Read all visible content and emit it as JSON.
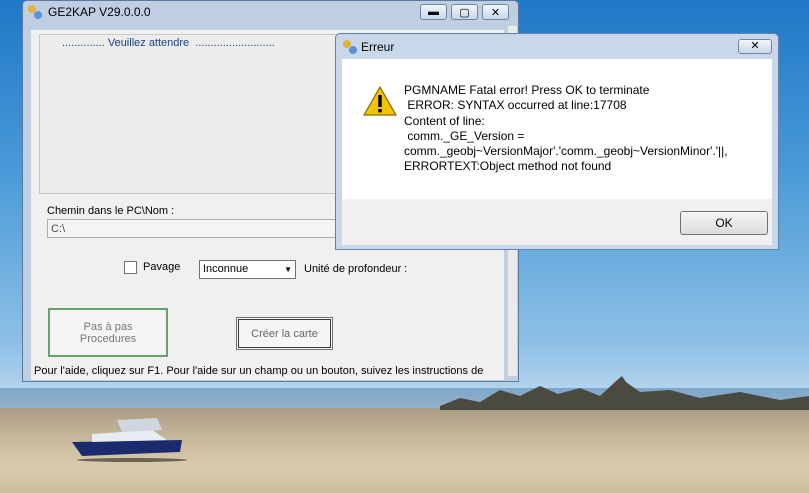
{
  "main_window": {
    "title": "GE2KAP V29.0.0.0",
    "minimize": "▬",
    "maximize": "▢",
    "close": "✕",
    "wait_text": ".............. Veuillez attendre  ..........................",
    "path_label": "Chemin dans le PC\\Nom :",
    "path_value": "C:\\",
    "pavage_label": "Pavage",
    "pavage_checked": false,
    "depth_unit_selected": "Inconnue",
    "depth_unit_label": "Unité de profondeur :",
    "btn_pas_line1": "Pas à pas",
    "btn_pas_line2": "Procedures",
    "btn_creer": "Créer la carte",
    "help_text": "Pour l'aide, cliquez sur F1. Pour l'aide sur un champ ou un bouton, suivez les instructions de"
  },
  "error_dialog": {
    "title": "Erreur",
    "close": "✕",
    "icon": "warning-icon",
    "message": "PGMNAME Fatal error! Press OK to terminate\n ERROR: SYNTAX occurred at line:17708\nContent of line:\n comm._GE_Version =\ncomm._geobj~VersionMajor'.'comm._geobj~VersionMinor'.'||,\nERRORTEXT:Object method not found",
    "ok_label": "OK"
  },
  "colors": {
    "accent_wait_text": "#1a3f8a",
    "warning_yellow": "#f2c200",
    "focus_green": "#6aa36a"
  }
}
